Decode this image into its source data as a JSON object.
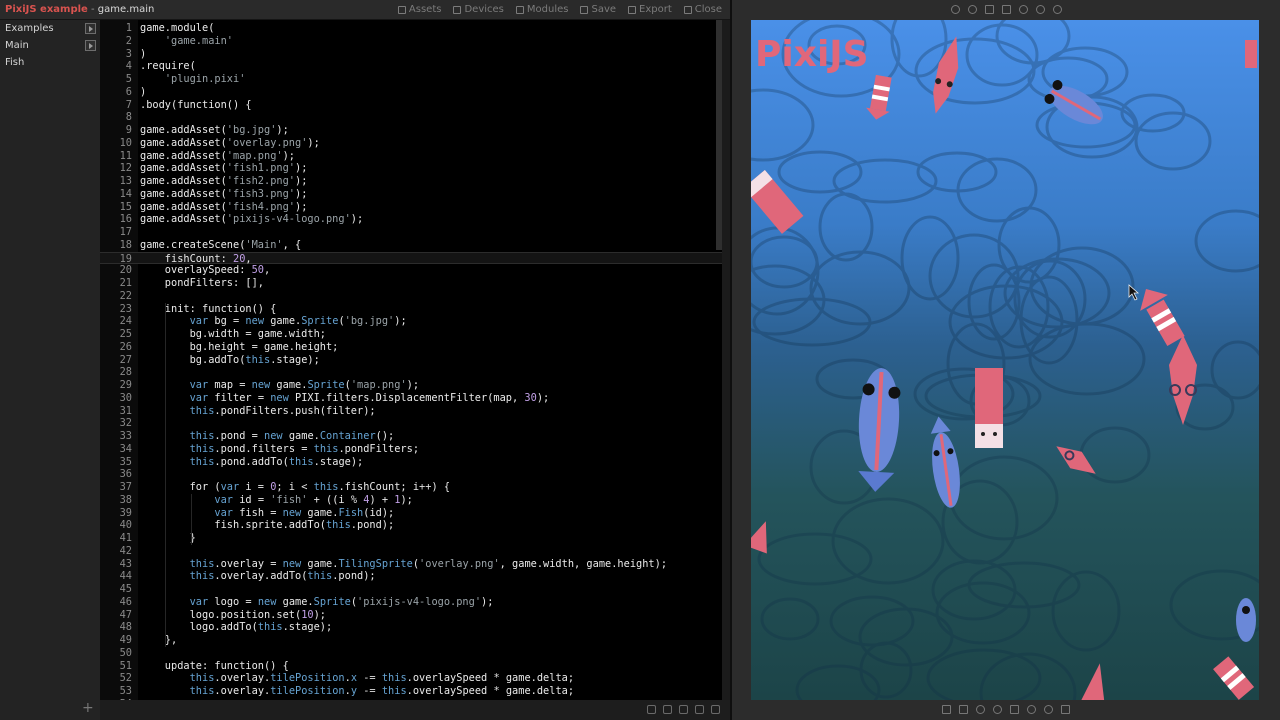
{
  "app": {
    "brand": "PixiJS example",
    "separator": " - ",
    "file": "game.main"
  },
  "toolbar": [
    {
      "label": "Assets",
      "icon": "assets-icon"
    },
    {
      "label": "Devices",
      "icon": "devices-icon"
    },
    {
      "label": "Modules",
      "icon": "modules-icon"
    },
    {
      "label": "Save",
      "icon": "save-icon"
    },
    {
      "label": "Export",
      "icon": "export-icon"
    },
    {
      "label": "Close",
      "icon": "close-icon"
    }
  ],
  "sidebar": {
    "items": [
      {
        "label": "Examples",
        "has_add": true
      },
      {
        "label": "Main",
        "has_add": true
      },
      {
        "label": "Fish",
        "has_add": false
      }
    ]
  },
  "editor": {
    "active_line": 19,
    "lines": [
      "game.module(",
      "    'game.main'",
      ")",
      ".require(",
      "    'plugin.pixi'",
      ")",
      ".body(function() {",
      "",
      "game.addAsset('bg.jpg');",
      "game.addAsset('overlay.png');",
      "game.addAsset('map.png');",
      "game.addAsset('fish1.png');",
      "game.addAsset('fish2.png');",
      "game.addAsset('fish3.png');",
      "game.addAsset('fish4.png');",
      "game.addAsset('pixijs-v4-logo.png');",
      "",
      "game.createScene('Main', {",
      "    fishCount: 20,",
      "    overlaySpeed: 50,",
      "    pondFilters: [],",
      "",
      "    init: function() {",
      "        var bg = new game.Sprite('bg.jpg');",
      "        bg.width = game.width;",
      "        bg.height = game.height;",
      "        bg.addTo(this.stage);",
      "",
      "        var map = new game.Sprite('map.png');",
      "        var filter = new PIXI.filters.DisplacementFilter(map, 30);",
      "        this.pondFilters.push(filter);",
      "",
      "        this.pond = new game.Container();",
      "        this.pond.filters = this.pondFilters;",
      "        this.pond.addTo(this.stage);",
      "",
      "        for (var i = 0; i < this.fishCount; i++) {",
      "            var id = 'fish' + ((i % 4) + 1);",
      "            var fish = new game.Fish(id);",
      "            fish.sprite.addTo(this.pond);",
      "        }",
      "",
      "        this.overlay = new game.TilingSprite('overlay.png', game.width, game.height);",
      "        this.overlay.addTo(this.pond);",
      "",
      "        var logo = new game.Sprite('pixijs-v4-logo.png');",
      "        logo.position.set(10);",
      "        logo.addTo(this.stage);",
      "    },",
      "",
      "    update: function() {",
      "        this.overlay.tilePosition.x -= this.overlaySpeed * game.delta;",
      "        this.overlay.tilePosition.y -= this.overlaySpeed * game.delta;",
      "        ..."
    ]
  },
  "preview": {
    "logo_text": "PixiJS",
    "colors": {
      "water_top": "#3f86dd",
      "water_mid": "#2c5f8a",
      "water_bottom": "#1f4a4e",
      "fish_pink": "#e0677a",
      "fish_blue": "#6a88d8"
    }
  },
  "colors": {
    "brand": "#d9534f",
    "editor_bg": "#000000",
    "keyword": "#66a3d2",
    "number": "#c1a0e6",
    "string": "#9aa3a8"
  }
}
